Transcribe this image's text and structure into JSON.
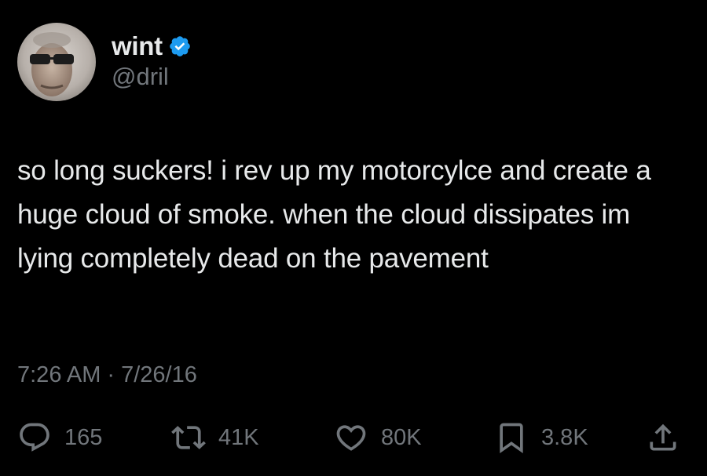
{
  "user": {
    "display_name": "wint",
    "handle": "@dril",
    "verified": true,
    "verified_color": "#1d9bf0"
  },
  "tweet": {
    "text": "so long suckers! i rev up my motorcylce and create a huge cloud of smoke. when the cloud dissipates im lying completely dead on the pavement",
    "time": "7:26 AM",
    "separator": "·",
    "date": "7/26/16"
  },
  "actions": {
    "reply": {
      "icon": "reply-icon",
      "count": "165"
    },
    "retweet": {
      "icon": "retweet-icon",
      "count": "41K"
    },
    "like": {
      "icon": "heart-icon",
      "count": "80K"
    },
    "bookmark": {
      "icon": "bookmark-icon",
      "count": "3.8K"
    },
    "share": {
      "icon": "share-icon"
    }
  },
  "colors": {
    "background": "#000000",
    "primary_text": "#e7e9ea",
    "secondary_text": "#71767b"
  }
}
